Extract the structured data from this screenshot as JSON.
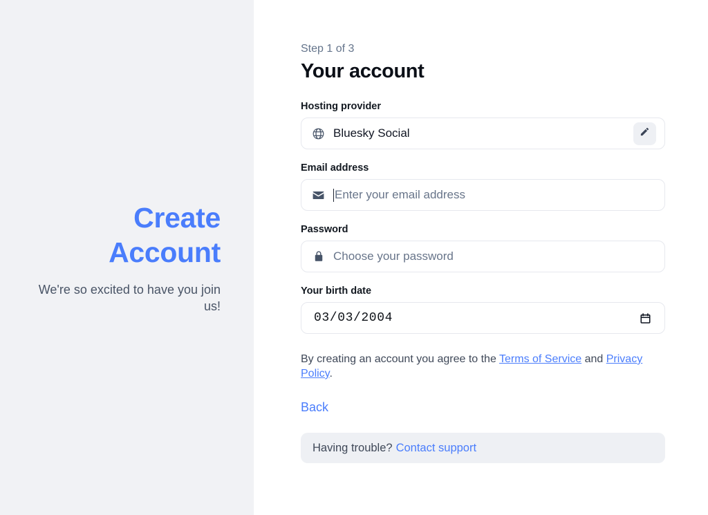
{
  "left_panel": {
    "title_line1": "Create",
    "title_line2": "Account",
    "subtitle": "We're so excited to have you join us!",
    "background_color": "#f1f2f5",
    "title_color": "#4a7dfc"
  },
  "form": {
    "step_label": "Step 1 of 3",
    "title": "Your account",
    "hosting": {
      "label": "Hosting provider",
      "value": "Bluesky Social",
      "icon": "globe-icon",
      "edit_icon": "pencil-icon"
    },
    "email": {
      "label": "Email address",
      "value": "",
      "placeholder": "Enter your email address",
      "icon": "envelope-icon",
      "focused": true
    },
    "password": {
      "label": "Password",
      "value": "",
      "placeholder": "Choose your password",
      "icon": "lock-icon"
    },
    "birth_date": {
      "label": "Your birth date",
      "value": "03/03/2004",
      "icon": "calendar-icon"
    },
    "terms": {
      "text_before": "By creating an account you agree to the ",
      "link_tos": "Terms of Service",
      "text_middle": " and ",
      "link_privacy": "Privacy Policy",
      "text_after": "."
    },
    "back_label": "Back",
    "support": {
      "text": "Having trouble?",
      "link": "Contact support"
    }
  }
}
